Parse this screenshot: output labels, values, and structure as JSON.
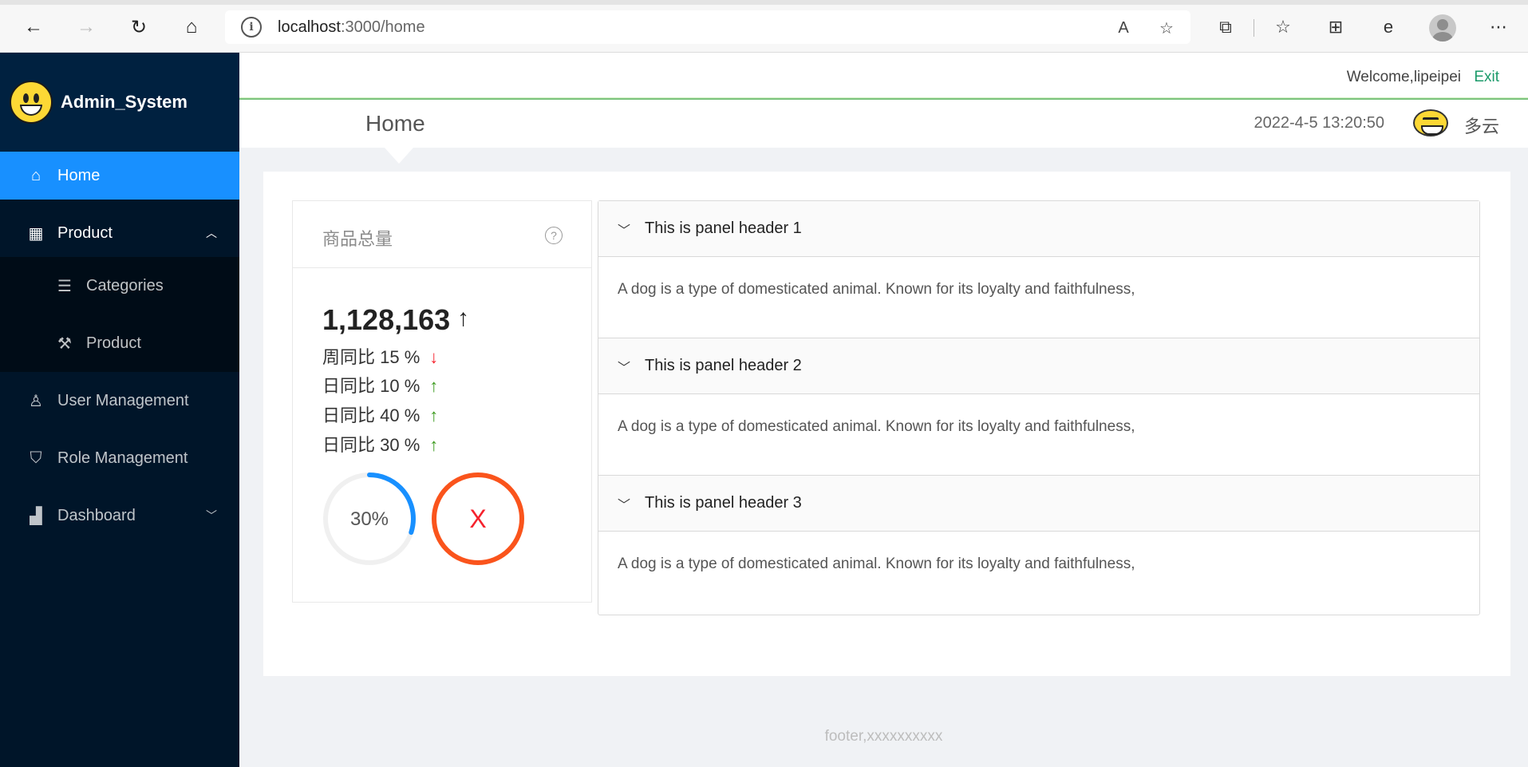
{
  "browser": {
    "url_host": "localhost",
    "url_path": ":3000/home"
  },
  "brand": {
    "title": "Admin_System"
  },
  "sidebar": {
    "items": [
      {
        "label": "Home",
        "icon": "home-icon"
      },
      {
        "label": "Product",
        "icon": "appstore-icon"
      },
      {
        "label": "User Management",
        "icon": "user-icon"
      },
      {
        "label": "Role Management",
        "icon": "safety-icon"
      },
      {
        "label": "Dashboard",
        "icon": "chart-icon"
      }
    ],
    "product_sub": [
      {
        "label": "Categories",
        "icon": "list-icon"
      },
      {
        "label": "Product",
        "icon": "tool-icon"
      }
    ]
  },
  "header": {
    "welcome": "Welcome,lipeipei",
    "exit": "Exit",
    "page_title": "Home",
    "datetime": "2022-4-5 13:20:50",
    "weather": "多云"
  },
  "card": {
    "title": "商品总量",
    "total": "1,128,163",
    "total_arrow": "↑",
    "stats": [
      {
        "label": "周同比 15 %",
        "arrow": "↓",
        "dir": "down"
      },
      {
        "label": "日同比 10 %",
        "arrow": "↑",
        "dir": "up"
      },
      {
        "label": "日同比 40 %",
        "arrow": "↑",
        "dir": "up"
      },
      {
        "label": "日同比 30 %",
        "arrow": "↑",
        "dir": "up"
      }
    ],
    "progress_percent": 30,
    "progress_label": "30%",
    "error_symbol": "X",
    "colors": {
      "progress": "#1890ff",
      "error": "#fa541c",
      "track": "#f0f0f0"
    }
  },
  "panels": [
    {
      "header": "This is panel header 1",
      "body": "A dog is a type of domesticated animal. Known for its loyalty and faithfulness,"
    },
    {
      "header": "This is panel header 2",
      "body": "A dog is a type of domesticated animal. Known for its loyalty and faithfulness,"
    },
    {
      "header": "This is panel header 3",
      "body": "A dog is a type of domesticated animal. Known for its loyalty and faithfulness,"
    }
  ],
  "footer": "footer,xxxxxxxxxx",
  "theme": {
    "sidebar_bg": "#001529",
    "active": "#1890ff",
    "exit_color": "#1b9a6a"
  }
}
